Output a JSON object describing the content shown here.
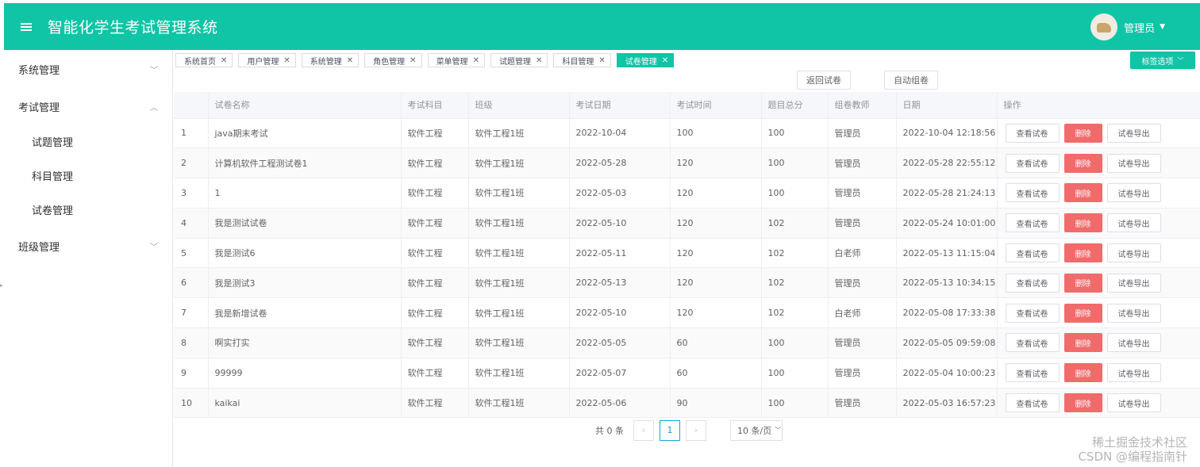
{
  "header": {
    "title": "智能化学生考试管理系统",
    "user": "管理员"
  },
  "sidebar": {
    "menus": [
      {
        "label": "系统管理",
        "expanded": false
      },
      {
        "label": "考试管理",
        "expanded": true
      },
      {
        "label": "班级管理",
        "expanded": false
      }
    ],
    "exam_sub": [
      "试题管理",
      "科目管理",
      "试卷管理"
    ]
  },
  "tags": [
    {
      "label": "系统首页",
      "active": false
    },
    {
      "label": "用户管理",
      "active": false
    },
    {
      "label": "系统管理",
      "active": false
    },
    {
      "label": "角色管理",
      "active": false
    },
    {
      "label": "菜单管理",
      "active": false
    },
    {
      "label": "试题管理",
      "active": false
    },
    {
      "label": "科目管理",
      "active": false
    },
    {
      "label": "试卷管理",
      "active": true
    }
  ],
  "tag_options": "标签选项",
  "buttons": {
    "return": "返回试卷",
    "auto": "自动组卷"
  },
  "table": {
    "headers": [
      "",
      "试卷名称",
      "考试科目",
      "班级",
      "考试日期",
      "考试时间",
      "题目总分",
      "组卷教师",
      "日期",
      "操作"
    ],
    "rows": [
      [
        "1",
        "java期末考试",
        "软件工程",
        "软件工程1班",
        "2022-10-04",
        "100",
        "100",
        "管理员",
        "2022-10-04 12:18:56"
      ],
      [
        "2",
        "计算机软件工程测试卷1",
        "软件工程",
        "软件工程1班",
        "2022-05-28",
        "120",
        "100",
        "管理员",
        "2022-05-28 22:55:12"
      ],
      [
        "3",
        "1",
        "软件工程",
        "软件工程1班",
        "2022-05-03",
        "120",
        "100",
        "管理员",
        "2022-05-28 21:24:13"
      ],
      [
        "4",
        "我是测试试卷",
        "软件工程",
        "软件工程1班",
        "2022-05-10",
        "120",
        "102",
        "管理员",
        "2022-05-24 10:01:00"
      ],
      [
        "5",
        "我是测试6",
        "软件工程",
        "软件工程1班",
        "2022-05-11",
        "120",
        "102",
        "白老师",
        "2022-05-13 11:15:04"
      ],
      [
        "6",
        "我是测试3",
        "软件工程",
        "软件工程1班",
        "2022-05-13",
        "120",
        "102",
        "管理员",
        "2022-05-13 10:34:15"
      ],
      [
        "7",
        "我是新增试卷",
        "软件工程",
        "软件工程1班",
        "2022-05-10",
        "120",
        "102",
        "白老师",
        "2022-05-08 17:33:38"
      ],
      [
        "8",
        "啊实打实",
        "软件工程",
        "软件工程1班",
        "2022-05-05",
        "60",
        "100",
        "管理员",
        "2022-05-05 09:59:08"
      ],
      [
        "9",
        "99999",
        "软件工程",
        "软件工程1班",
        "2022-05-07",
        "60",
        "100",
        "管理员",
        "2022-05-04 10:00:23"
      ],
      [
        "10",
        "kaikai",
        "软件工程",
        "软件工程1班",
        "2022-05-06",
        "90",
        "100",
        "管理员",
        "2022-05-03 16:57:23"
      ]
    ],
    "actions": {
      "view": "查看试卷",
      "delete": "删除",
      "export": "试卷导出"
    }
  },
  "pagination": {
    "total": "共 0 条",
    "prev": "‹",
    "page": "1",
    "next": "›",
    "page_size": "10 条/页"
  },
  "watermark": [
    "稀土掘金技术社区",
    "CSDN @编程指南针"
  ],
  "colors": {
    "primary": "#10c4a6",
    "danger": "#f16b6b"
  }
}
